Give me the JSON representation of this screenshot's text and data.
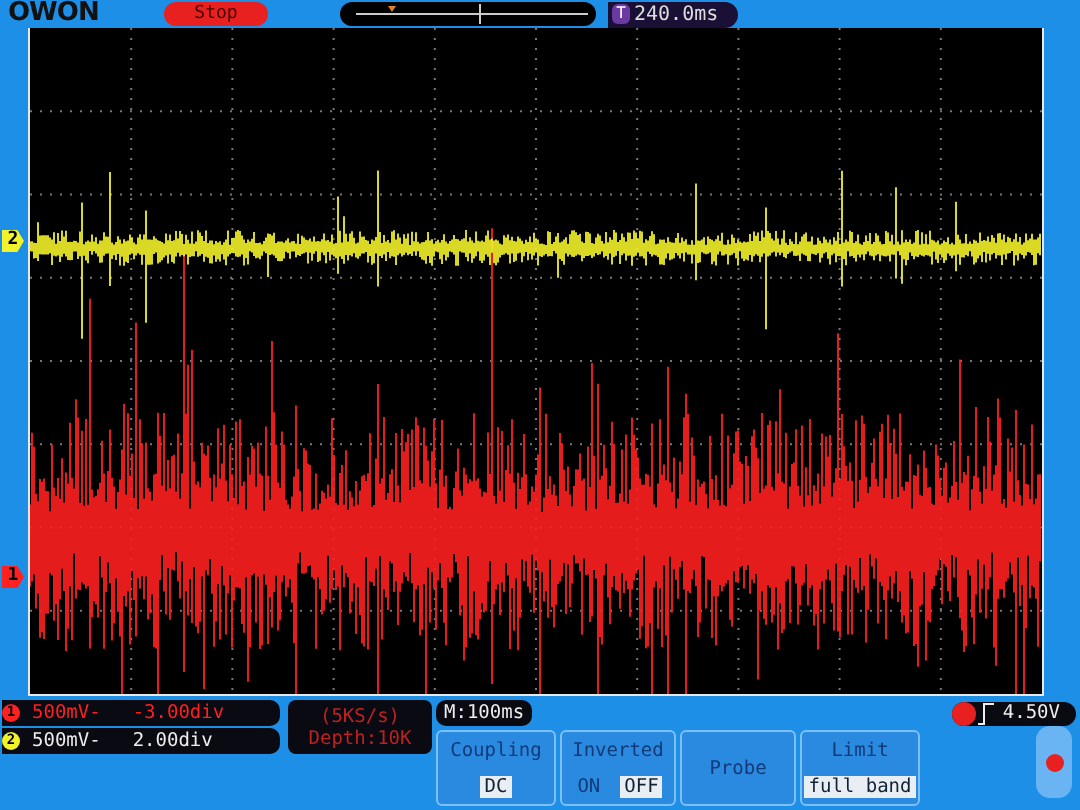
{
  "header": {
    "logo": "OWON",
    "run_state": "Stop",
    "trigger_position": {
      "badge": "T",
      "value": "240.0ms"
    }
  },
  "screen_markers": [
    {
      "label": "2",
      "color": "#f2f22a"
    },
    {
      "label": "1",
      "color": "#ff2020"
    }
  ],
  "channels": [
    {
      "badge": "1",
      "color": "#ff2020",
      "scale": "500mV-",
      "offset": "-3.00div"
    },
    {
      "badge": "2",
      "color": "#f2f22a",
      "scale": "500mV-",
      "offset": "2.00div"
    }
  ],
  "acquisition": {
    "rate": "(5KS/s)",
    "depth": "Depth:10K"
  },
  "timebase": "M:100ms",
  "trigger": {
    "level": "4.50V"
  },
  "menu": [
    {
      "kind": "value",
      "title": "Coupling",
      "value": "DC"
    },
    {
      "kind": "toggle",
      "title": "Inverted",
      "options": [
        {
          "label": "ON",
          "selected": false
        },
        {
          "label": "OFF",
          "selected": true
        }
      ]
    },
    {
      "kind": "plain",
      "title": "Probe"
    },
    {
      "kind": "value",
      "title": "Limit",
      "value": "full band"
    }
  ]
}
